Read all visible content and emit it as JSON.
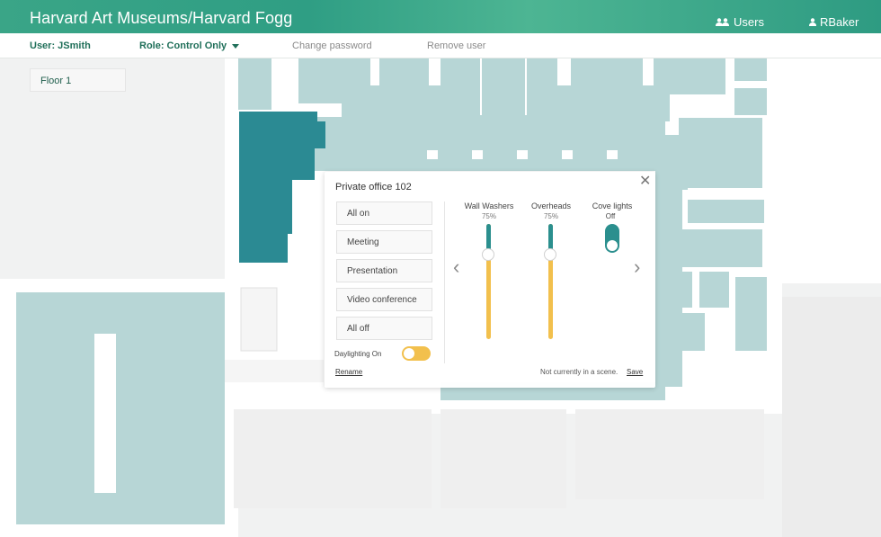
{
  "header": {
    "title": "Harvard Art Museums/Harvard Fogg",
    "users_label": "Users",
    "current_user": "RBaker"
  },
  "subbar": {
    "user": "User: JSmith",
    "role": "Role: Control Only",
    "change_password": "Change password",
    "remove_user": "Remove user"
  },
  "floor_selector": {
    "selected": "Floor 1"
  },
  "popup": {
    "title": "Private office 102",
    "scenes": [
      "All on",
      "Meeting",
      "Presentation",
      "Video conference",
      "All off"
    ],
    "daylighting_label": "Daylighting On",
    "daylighting_on": true,
    "rename_label": "Rename",
    "scene_status": "Not currently in a scene.",
    "save_label": "Save",
    "zones": [
      {
        "name": "Wall Washers",
        "value": "75%",
        "level": 0.75
      },
      {
        "name": "Overheads",
        "value": "75%",
        "level": 0.75
      },
      {
        "name": "Cove lights",
        "value": "Off",
        "on": false
      }
    ]
  },
  "colors": {
    "header": "#2f9e84",
    "room_fill": "#b7d6d6",
    "selected_room": "#2b8a93",
    "slider_track": "#f2c04d",
    "slider_fill": "#2b8f8e"
  }
}
